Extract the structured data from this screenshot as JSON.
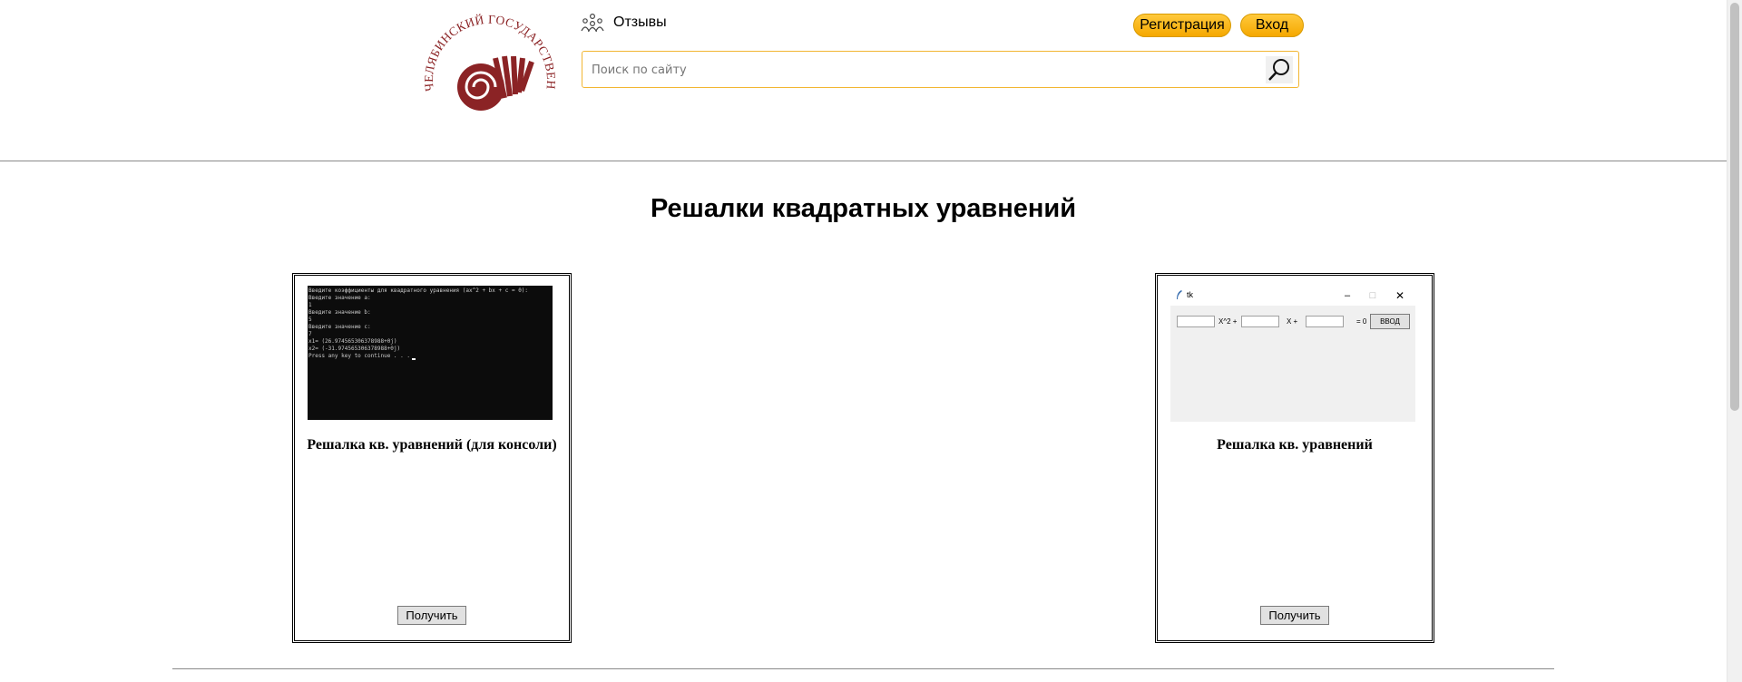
{
  "header": {
    "logo_text": "ЧЕЛЯБИНСКИЙ ГОСУДАРСТВЕННЫЙ УНИВЕРСИТЕТ",
    "reviews_label": "Отзывы",
    "register_label": "Регистрация",
    "login_label": "Вход",
    "search_placeholder": "Поиск по сайту",
    "search_value": ""
  },
  "main": {
    "title": "Решалки квадратных уравнений",
    "cards": [
      {
        "title": "Решалка кв. уравнений (для консоли)",
        "button_label": "Получить",
        "console_lines": [
          "Введите коэффициенты для квадратного уравнения (ax^2 + bx + c = 0):",
          "Введите значение a:",
          "1",
          "Введите значение b:",
          "5",
          "Введите значение c:",
          "7",
          "x1= (26.974565306378988+0j)",
          "x2= (-31.974565306378988+0j)",
          "Press any key to continue . . ."
        ]
      },
      {
        "title": "Решалка кв. уравнений",
        "button_label": "Получить",
        "tk_window": {
          "title": "tk",
          "label_x2": "X^2 +",
          "label_x": "X +",
          "label_eq": "= 0",
          "button": "ВВОД"
        }
      }
    ]
  },
  "colors": {
    "accent_yellow": "#f5a800",
    "logo_red": "#8b2325",
    "search_border": "#f2b632"
  }
}
